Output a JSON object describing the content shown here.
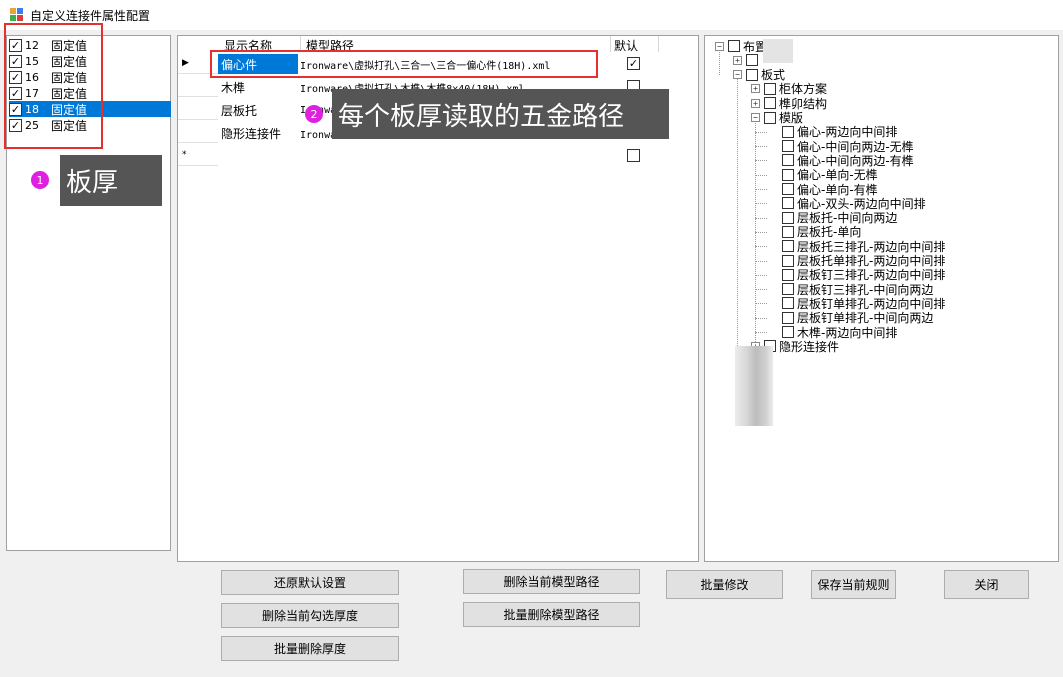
{
  "window": {
    "title": "自定义连接件属性配置"
  },
  "thickness_list": [
    {
      "value": "12",
      "label": "固定值",
      "checked": true,
      "selected": false
    },
    {
      "value": "15",
      "label": "固定值",
      "checked": true,
      "selected": false
    },
    {
      "value": "16",
      "label": "固定值",
      "checked": true,
      "selected": false
    },
    {
      "value": "17",
      "label": "固定值",
      "checked": true,
      "selected": false
    },
    {
      "value": "18",
      "label": "固定值",
      "checked": true,
      "selected": true
    },
    {
      "value": "25",
      "label": "固定值",
      "checked": true,
      "selected": false
    }
  ],
  "grid": {
    "headers": {
      "name": "显示名称",
      "path": "模型路径",
      "default": "默认"
    },
    "rows": [
      {
        "marker": "▶",
        "name": "偏心件",
        "path": "Ironware\\虚拟打孔\\三合一\\三合一偏心件(18H).xml",
        "default": true
      },
      {
        "marker": "",
        "name": "木榫",
        "path": "Ironware\\虚拟打孔\\木榫\\木榫8x40(18H).xml",
        "default": false
      },
      {
        "marker": "",
        "name": "层板托",
        "path": "Ironware\\",
        "default": false
      },
      {
        "marker": "",
        "name": "隐形连接件",
        "path": "Ironware\\虚拟打孔\\隐形件U型\\刀具中心\\U型连接件...",
        "default": false
      },
      {
        "marker": "*",
        "name": "",
        "path": "",
        "default": false
      }
    ]
  },
  "annotations": {
    "thickness": {
      "number": "1",
      "text": "板厚"
    },
    "path": {
      "number": "2",
      "text": "每个板厚读取的五金路径"
    }
  },
  "tree": [
    {
      "label": "布置方案",
      "expander": "−",
      "checked": false
    },
    {
      "label": "",
      "expander": "+",
      "checked": false
    },
    {
      "label": "板式",
      "expander": "−",
      "checked": false
    },
    {
      "label": "柜体方案",
      "expander": "+",
      "checked": false
    },
    {
      "label": "榫卯结构",
      "expander": "+",
      "checked": false
    },
    {
      "label": "模版",
      "expander": "−",
      "checked": false
    },
    {
      "label": "偏心-两边向中间排",
      "expander": "",
      "checked": false
    },
    {
      "label": "偏心-中间向两边-无榫",
      "expander": "",
      "checked": false
    },
    {
      "label": "偏心-中间向两边-有榫",
      "expander": "",
      "checked": false
    },
    {
      "label": "偏心-单向-无榫",
      "expander": "",
      "checked": false
    },
    {
      "label": "偏心-单向-有榫",
      "expander": "",
      "checked": false
    },
    {
      "label": "偏心-双头-两边向中间排",
      "expander": "",
      "checked": false
    },
    {
      "label": "层板托-中间向两边",
      "expander": "",
      "checked": false
    },
    {
      "label": "层板托-单向",
      "expander": "",
      "checked": false
    },
    {
      "label": "层板托三排孔-两边向中间排",
      "expander": "",
      "checked": false
    },
    {
      "label": "层板托单排孔-两边向中间排",
      "expander": "",
      "checked": false
    },
    {
      "label": "层板钉三排孔-两边向中间排",
      "expander": "",
      "checked": false
    },
    {
      "label": "层板钉三排孔-中间向两边",
      "expander": "",
      "checked": false
    },
    {
      "label": "层板钉单排孔-两边向中间排",
      "expander": "",
      "checked": false
    },
    {
      "label": "层板钉单排孔-中间向两边",
      "expander": "",
      "checked": false
    },
    {
      "label": "木榫-两边向中间排",
      "expander": "",
      "checked": false
    },
    {
      "label": "隐形连接件",
      "expander": "+",
      "checked": false
    }
  ],
  "buttons": {
    "restore_default": "还原默认设置",
    "delete_checked_thickness": "删除当前勾选厚度",
    "batch_delete_thickness": "批量删除厚度",
    "delete_current_path": "删除当前模型路径",
    "batch_delete_path": "批量删除模型路径",
    "batch_modify": "批量修改",
    "save_rule": "保存当前规则",
    "close": "关闭"
  },
  "colors": {
    "selection": "#0078d7",
    "highlight_border": "#e53030",
    "callout_bg": "#555555",
    "badge": "#e020e0"
  }
}
